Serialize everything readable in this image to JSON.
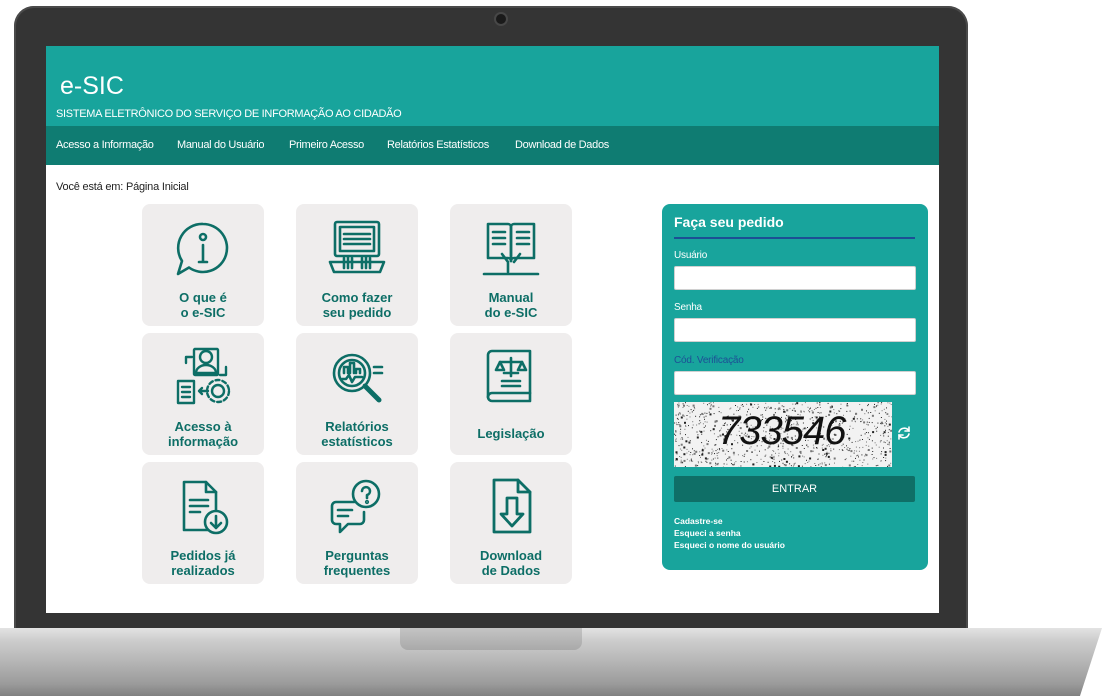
{
  "header": {
    "title": "e-SIC",
    "subtitle": "SISTEMA ELETRÔNICO DO SERVIÇO DE INFORMAÇÃO AO CIDADÃO"
  },
  "nav": {
    "items": [
      {
        "label": "Acesso a Informação"
      },
      {
        "label": "Manual do Usuário"
      },
      {
        "label": "Primeiro Acesso"
      },
      {
        "label": "Relatórios Estatísticos"
      },
      {
        "label": "Download de Dados"
      }
    ]
  },
  "breadcrumb": "Você está em: Página Inicial",
  "tiles": [
    {
      "label": "O que é\no e-SIC",
      "icon": "info-chat-icon"
    },
    {
      "label": "Como fazer\nseu pedido",
      "icon": "laptop-typing-icon"
    },
    {
      "label": "Manual\ndo e-SIC",
      "icon": "manual-book-icon"
    },
    {
      "label": "Acesso à\ninformação",
      "icon": "access-information-icon"
    },
    {
      "label": "Relatórios\nestatísticos",
      "icon": "statistics-magnifier-icon"
    },
    {
      "label": "Legislação",
      "icon": "law-book-icon"
    },
    {
      "label": "Pedidos já\nrealizados",
      "icon": "document-download-icon"
    },
    {
      "label": "Perguntas\nfrequentes",
      "icon": "faq-chat-icon"
    },
    {
      "label": "Download\nde Dados",
      "icon": "file-download-icon"
    }
  ],
  "login": {
    "title": "Faça seu pedido",
    "username_label": "Usuário",
    "username_value": "",
    "password_label": "Senha",
    "password_value": "",
    "captcha_label": "Cód. Verificação",
    "captcha_value": "",
    "captcha_text": "733546",
    "submit_label": "ENTRAR",
    "links": [
      {
        "label": "Cadastre-se"
      },
      {
        "label": "Esqueci a senha"
      },
      {
        "label": "Esqueci o nome do usuário"
      }
    ]
  },
  "colors": {
    "header": "#18a49c",
    "nav": "#0f7c72",
    "tile_bg": "#efeded",
    "tile_text": "#0d6e66",
    "login_button": "#0f6f67",
    "login_accent": "#1d4f96"
  }
}
